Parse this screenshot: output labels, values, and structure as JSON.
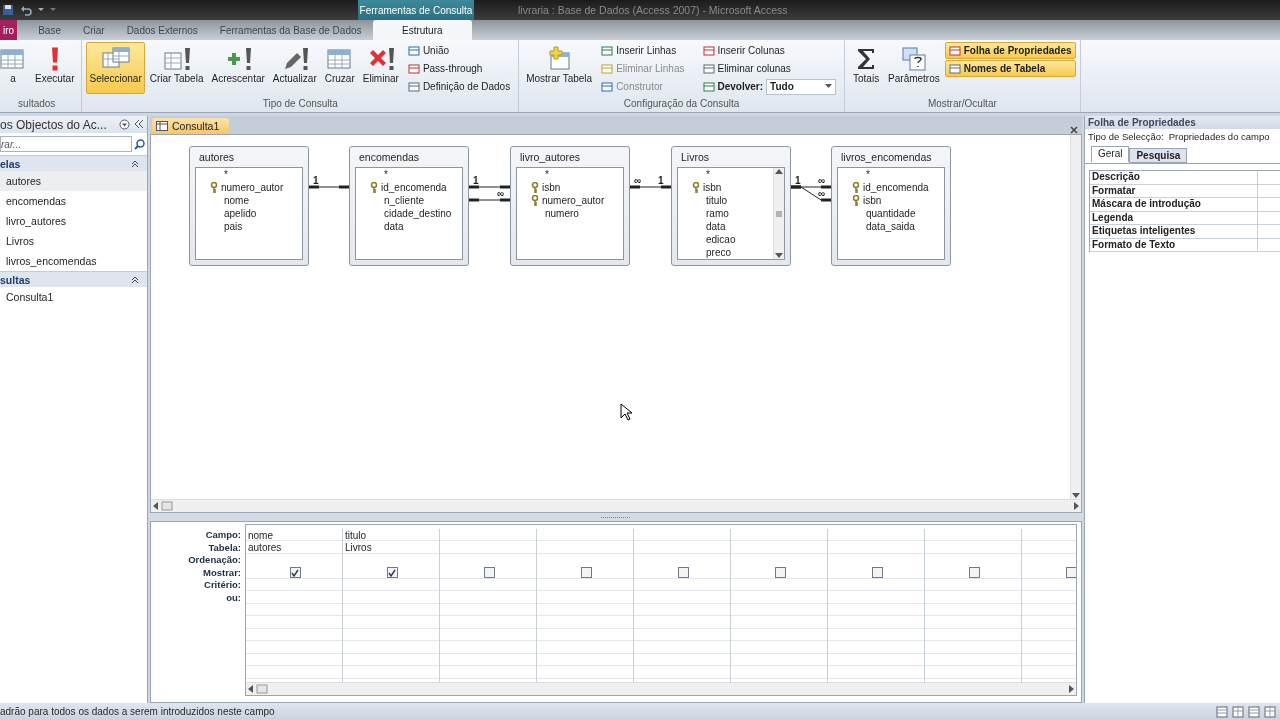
{
  "window": {
    "title": "livraria : Base de Dados (Access 2007)  -  Microsoft Access",
    "context_tab": "Ferramentas de Consulta"
  },
  "ribbon_tabs": [
    {
      "label": "iro",
      "kind": "file",
      "selected": false
    },
    {
      "label": "Base",
      "kind": "normal",
      "selected": false
    },
    {
      "label": "Criar",
      "kind": "normal",
      "selected": false
    },
    {
      "label": "Dados Externos",
      "kind": "normal",
      "selected": false
    },
    {
      "label": "Ferramentas da Base de Dados",
      "kind": "normal",
      "selected": false
    },
    {
      "label": "Estrutura",
      "kind": "normal",
      "selected": true
    }
  ],
  "ribbon_groups": [
    {
      "label": "sultados",
      "items": [
        {
          "kind": "large",
          "label": "a",
          "selected": false,
          "disabled": false
        },
        {
          "kind": "large",
          "label": "Executar",
          "selected": false,
          "disabled": false
        }
      ]
    },
    {
      "label": "Tipo de Consulta",
      "items": [
        {
          "kind": "large",
          "label": "Seleccionar",
          "selected": true,
          "disabled": false
        },
        {
          "kind": "large",
          "label": "Criar Tabela",
          "selected": false,
          "disabled": false
        },
        {
          "kind": "large",
          "label": "Acrescentar",
          "selected": false,
          "disabled": false
        },
        {
          "kind": "large",
          "label": "Actualizar",
          "selected": false,
          "disabled": false
        },
        {
          "kind": "large",
          "label": "Cruzar",
          "selected": false,
          "disabled": false
        },
        {
          "kind": "large",
          "label": "Eliminar",
          "selected": false,
          "disabled": false
        },
        {
          "kind": "small",
          "label": "União",
          "selected": false,
          "disabled": false
        },
        {
          "kind": "small",
          "label": "Pass-through",
          "selected": false,
          "disabled": false
        },
        {
          "kind": "small",
          "label": "Definição de Dados",
          "selected": false,
          "disabled": false
        }
      ]
    },
    {
      "label": "Configuração da Consulta",
      "items": [
        {
          "kind": "large",
          "label": "Mostrar Tabela",
          "selected": false,
          "disabled": false
        },
        {
          "kind": "small",
          "label": "Inserir Linhas",
          "selected": false,
          "disabled": false
        },
        {
          "kind": "small",
          "label": "Eliminar Linhas",
          "selected": false,
          "disabled": true
        },
        {
          "kind": "small",
          "label": "Construtor",
          "selected": false,
          "disabled": true
        },
        {
          "kind": "small",
          "label": "Inserir Colunas",
          "selected": false,
          "disabled": false
        },
        {
          "kind": "small",
          "label": "Eliminar colunas",
          "selected": false,
          "disabled": false
        },
        {
          "kind": "dropdown",
          "label": "Devolver:",
          "value": "Tudo",
          "selected": false,
          "disabled": false
        }
      ]
    },
    {
      "label": "Mostrar/Ocultar",
      "items": [
        {
          "kind": "large",
          "label": "Totais",
          "selected": false,
          "disabled": false
        },
        {
          "kind": "large",
          "label": "Parâmetros",
          "selected": false,
          "disabled": false
        },
        {
          "kind": "small",
          "label": "Folha de Propriedades",
          "selected": true,
          "disabled": false
        },
        {
          "kind": "small",
          "label": "Nomes de Tabela",
          "selected": true,
          "disabled": false
        }
      ]
    }
  ],
  "nav_pane": {
    "title": "os Objectos do Ac...",
    "search": {
      "placeholder": "rar..."
    },
    "sections": [
      {
        "label": "elas",
        "expanded": true,
        "items": [
          {
            "label": "autores",
            "selected": true
          },
          {
            "label": "encomendas",
            "selected": false
          },
          {
            "label": "livro_autores",
            "selected": false
          },
          {
            "label": "Livros",
            "selected": false
          },
          {
            "label": "livros_encomendas",
            "selected": false
          }
        ]
      },
      {
        "label": "sultas",
        "expanded": true,
        "items": [
          {
            "label": "Consulta1",
            "selected": false
          }
        ]
      }
    ]
  },
  "document_tab": {
    "label": "Consulta1"
  },
  "tables": [
    {
      "name": "autores",
      "scrollable": false,
      "fields": [
        {
          "name": "*",
          "key": false
        },
        {
          "name": "numero_autor",
          "key": true
        },
        {
          "name": "nome",
          "key": false
        },
        {
          "name": "apelido",
          "key": false
        },
        {
          "name": "pais",
          "key": false
        }
      ]
    },
    {
      "name": "encomendas",
      "scrollable": false,
      "fields": [
        {
          "name": "*",
          "key": false
        },
        {
          "name": "id_encomenda",
          "key": true
        },
        {
          "name": "n_cliente",
          "key": false
        },
        {
          "name": "cidade_destino",
          "key": false
        },
        {
          "name": "data",
          "key": false
        }
      ]
    },
    {
      "name": "livro_autores",
      "scrollable": false,
      "fields": [
        {
          "name": "*",
          "key": false
        },
        {
          "name": "isbn",
          "key": true
        },
        {
          "name": "numero_autor",
          "key": true
        },
        {
          "name": "numero",
          "key": false
        }
      ]
    },
    {
      "name": "Livros",
      "scrollable": true,
      "fields": [
        {
          "name": "*",
          "key": false
        },
        {
          "name": "isbn",
          "key": true
        },
        {
          "name": "titulo",
          "key": false
        },
        {
          "name": "ramo",
          "key": false
        },
        {
          "name": "data",
          "key": false
        },
        {
          "name": "edicao",
          "key": false
        },
        {
          "name": "preco",
          "key": false
        }
      ]
    },
    {
      "name": "livros_encomendas",
      "scrollable": false,
      "fields": [
        {
          "name": "*",
          "key": false
        },
        {
          "name": "id_encomenda",
          "key": true
        },
        {
          "name": "isbn",
          "key": true
        },
        {
          "name": "quantidade",
          "key": false
        },
        {
          "name": "data_saida",
          "key": false
        }
      ]
    }
  ],
  "relationships": [
    {
      "from_mark": "1"
    },
    {
      "from_mark": "1"
    },
    {
      "to_mark": "∞"
    },
    {
      "from_mark": "∞",
      "to_mark": "1"
    },
    {
      "from_mark": "1",
      "to_mark": "∞"
    },
    {
      "to_mark": "∞"
    }
  ],
  "query_grid": {
    "row_labels": [
      "Campo:",
      "Tabela:",
      "Ordenação:",
      "Mostrar:",
      "Critério:",
      "ou:"
    ],
    "columns": [
      {
        "field": "nome",
        "table": "autores",
        "show": true
      },
      {
        "field": "titulo",
        "table": "Livros",
        "show": true
      },
      {
        "show": false
      },
      {
        "show": false
      },
      {
        "show": false
      },
      {
        "show": false
      },
      {
        "show": false
      },
      {
        "show": false
      },
      {
        "show": false
      }
    ]
  },
  "property_sheet": {
    "title": "Folha de Propriedades",
    "selection_label": "Tipo de Selecção:",
    "selection_value": "Propriedades do campo",
    "tabs": [
      {
        "label": "Geral",
        "selected": true
      },
      {
        "label": "Pesquisa",
        "selected": false
      }
    ],
    "properties": [
      "Descrição",
      "Formatar",
      "Máscara de introdução",
      "Legenda",
      "Etiquetas inteligentes",
      "Formato de Texto"
    ]
  },
  "status_bar": {
    "text": "adrão para todos os dados a serem introduzidos neste campo"
  }
}
